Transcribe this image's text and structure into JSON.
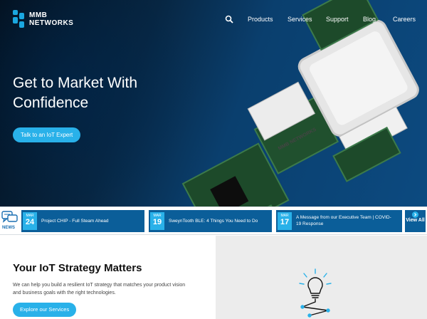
{
  "brand": {
    "line1": "MMB",
    "line2": "NETWORKS"
  },
  "nav": {
    "items": [
      "Products",
      "Services",
      "Support",
      "Blog",
      "Careers"
    ]
  },
  "hero": {
    "title": "Get to Market With Confidence",
    "cta": "Talk to an IoT Expert",
    "device_label": "MMB NETWORKS"
  },
  "news": {
    "label": "NEWS",
    "items": [
      {
        "month": "MAR",
        "day": "24",
        "text": "Project CHIP - Full Steam Ahead"
      },
      {
        "month": "MAR",
        "day": "19",
        "text": "SweynTooth BLE: 4 Things You Need to Do"
      },
      {
        "month": "MAR",
        "day": "17",
        "text": "A Message from our Executive Team | COVID-19 Response"
      }
    ],
    "view_all": "View All"
  },
  "strategy": {
    "title": "Your IoT Strategy Matters",
    "body": "We can help you build a resilient IoT strategy that matches your product vision and business goals with the right technologies.",
    "button": "Explore our Services"
  },
  "colors": {
    "accent": "#29b1e9",
    "news_bg": "#0b5e99",
    "hero_dark": "#03111f"
  }
}
